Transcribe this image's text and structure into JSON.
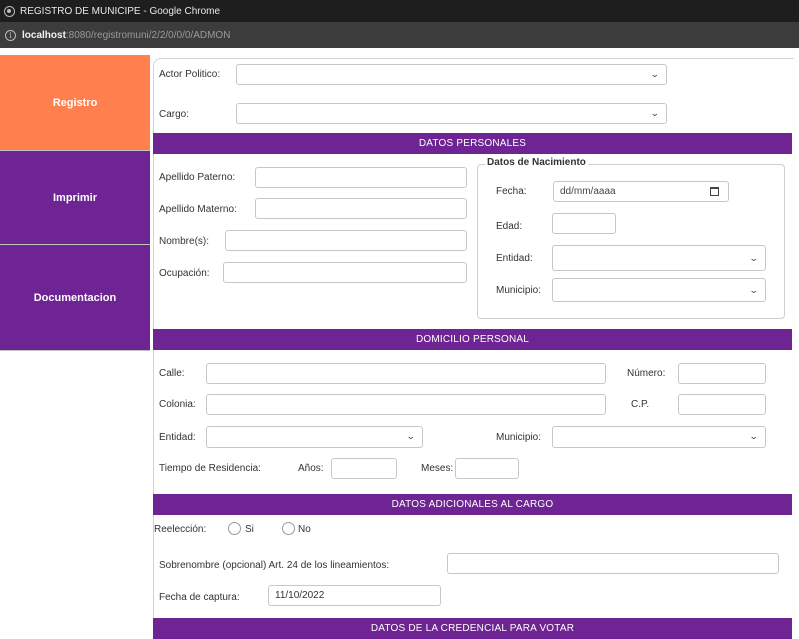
{
  "window": {
    "title": "REGISTRO DE MUNICIPE - Google Chrome",
    "url_host": "localhost",
    "url_rest": ":8080/registromuni/2/2/0/0/0/ADMON"
  },
  "sidebar": {
    "items": [
      {
        "label": "Registro",
        "active": true
      },
      {
        "label": "Imprimir",
        "active": false
      },
      {
        "label": "Documentacion",
        "active": false
      }
    ]
  },
  "colors": {
    "accent_orange": "#ff7f4e",
    "brand_purple": "#6e2493"
  },
  "top": {
    "actor_label": "Actor Politico:",
    "actor_value": "",
    "cargo_label": "Cargo:",
    "cargo_value": ""
  },
  "personales": {
    "header": "DATOS PERSONALES",
    "paterno_label": "Apellido Paterno:",
    "paterno_value": "",
    "materno_label": "Apellido Materno:",
    "materno_value": "",
    "nombre_label": "Nombre(s):",
    "nombre_value": "",
    "ocupacion_label": "Ocupación:",
    "ocupacion_value": ""
  },
  "nacimiento": {
    "legend": "Datos de Nacimiento",
    "fecha_label": "Fecha:",
    "fecha_placeholder": "dd/mm/aaaa",
    "edad_label": "Edad:",
    "edad_value": "",
    "entidad_label": "Entidad:",
    "entidad_value": "",
    "municipio_label": "Municipio:",
    "municipio_value": ""
  },
  "domicilio": {
    "header": "DOMICILIO PERSONAL",
    "calle_label": "Calle:",
    "calle_value": "",
    "numero_label": "Número:",
    "numero_value": "",
    "colonia_label": "Colonia:",
    "colonia_value": "",
    "cp_label": "C.P.",
    "cp_value": "",
    "entidad_label": "Entidad:",
    "entidad_value": "",
    "municipio_label": "Municipio:",
    "municipio_value": "",
    "tiempo_label": "Tiempo de Residencia:",
    "anios_label": "Años:",
    "anios_value": "",
    "meses_label": "Meses:",
    "meses_value": ""
  },
  "adicionales": {
    "header": "DATOS ADICIONALES AL CARGO",
    "reeleccion_label": "Reelección:",
    "si_label": "Si",
    "no_label": "No",
    "sobrenombre_label": "Sobrenombre (opcional) Art. 24 de los lineamientos:",
    "sobrenombre_value": "",
    "fecha_captura_label": "Fecha de captura:",
    "fecha_captura_value": "11/10/2022"
  },
  "credencial": {
    "header": "DATOS DE LA CREDENCIAL PARA VOTAR"
  }
}
